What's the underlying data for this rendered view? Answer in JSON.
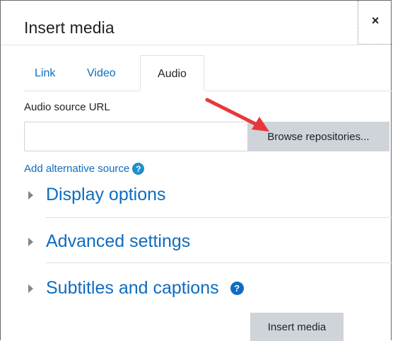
{
  "dialog": {
    "title": "Insert media",
    "close_label": "×"
  },
  "tabs": [
    {
      "label": "Link"
    },
    {
      "label": "Video"
    },
    {
      "label": "Audio",
      "active": true
    }
  ],
  "audio": {
    "source_label": "Audio source URL",
    "url_value": "",
    "browse_label": "Browse repositories...",
    "add_alternative_label": "Add alternative source",
    "help_glyph": "?"
  },
  "sections": [
    {
      "title": "Display options"
    },
    {
      "title": "Advanced settings"
    },
    {
      "title": "Subtitles and captions",
      "has_help": true
    }
  ],
  "footer": {
    "insert_label": "Insert media"
  },
  "colors": {
    "link": "#0f6cbf",
    "button_bg": "#ced4da",
    "arrow": "#e8373a",
    "help_icon": "#1f8ecd"
  },
  "icons": [
    "close-icon",
    "help-icon",
    "caret-right-icon",
    "arrow-annotation"
  ]
}
